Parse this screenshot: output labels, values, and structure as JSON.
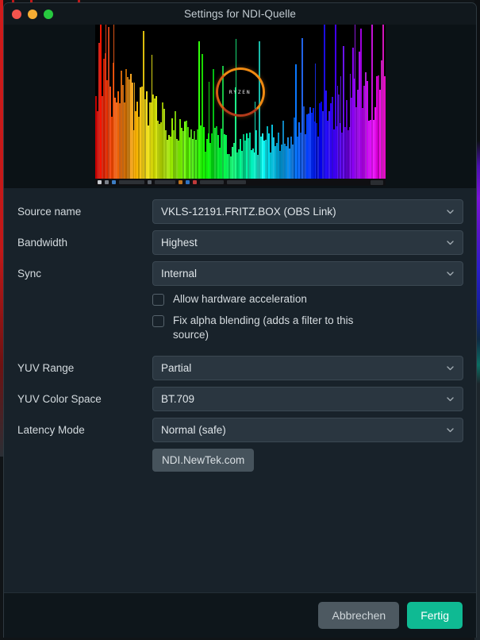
{
  "window": {
    "title": "Settings for NDI-Quelle",
    "traffic_lights": [
      {
        "name": "close",
        "color": "#f4544d"
      },
      {
        "name": "minimize",
        "color": "#f6ad33"
      },
      {
        "name": "maximize",
        "color": "#27c93f"
      }
    ]
  },
  "preview": {
    "alt": "NDI source video preview",
    "logo_text": "RYZEN",
    "description": "Rainbow audio spectrum visualizer with AMD Ryzen logo on black desktop"
  },
  "form": {
    "rows": [
      {
        "label": "Source name",
        "value": "VKLS-12191.FRITZ.BOX (OBS Link)",
        "name": "source-name"
      },
      {
        "label": "Bandwidth",
        "value": "Highest",
        "name": "bandwidth"
      },
      {
        "label": "Sync",
        "value": "Internal",
        "name": "sync"
      },
      {
        "label": "YUV Range",
        "value": "Partial",
        "name": "yuv-range"
      },
      {
        "label": "YUV Color Space",
        "value": "BT.709",
        "name": "yuv-color-space"
      },
      {
        "label": "Latency Mode",
        "value": "Normal (safe)",
        "name": "latency-mode"
      }
    ],
    "checkboxes": [
      {
        "label": "Allow hardware acceleration",
        "checked": false,
        "name": "allow-hardware-acceleration"
      },
      {
        "label": "Fix alpha blending (adds a filter to this source)",
        "checked": false,
        "name": "fix-alpha-blending"
      }
    ],
    "link_button": "NDI.NewTek.com"
  },
  "footer": {
    "cancel_label": "Abbrechen",
    "done_label": "Fertig"
  },
  "colors": {
    "accent": "#0fba93",
    "window_bg": "#18222a",
    "field_bg": "#2a3640",
    "header_bg": "#0c1419"
  }
}
